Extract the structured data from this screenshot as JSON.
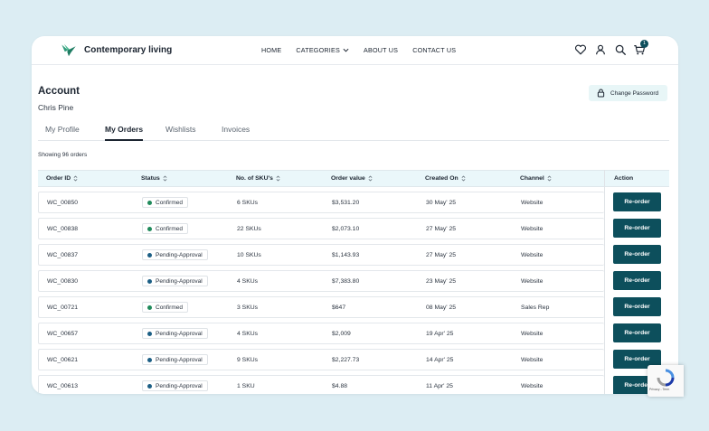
{
  "brand": {
    "name": "Contemporary living",
    "logo_icon": "bird-logo-icon"
  },
  "nav": {
    "items": [
      {
        "label": "HOME"
      },
      {
        "label": "CATEGORIES",
        "has_dropdown": true
      },
      {
        "label": "ABOUT US"
      },
      {
        "label": "CONTACT US"
      }
    ],
    "icons": [
      "heart-icon",
      "user-icon",
      "search-icon",
      "cart-icon"
    ],
    "cart_count": "1"
  },
  "account": {
    "title": "Account",
    "name": "Chris Pine",
    "change_password_label": "Change Password"
  },
  "tabs": [
    {
      "label": "My Profile",
      "active": false
    },
    {
      "label": "My Orders",
      "active": true
    },
    {
      "label": "Wishlists",
      "active": false
    },
    {
      "label": "Invoices",
      "active": false
    }
  ],
  "orders": {
    "showing": "Showing 96 orders",
    "columns": [
      "Order ID",
      "Status",
      "No. of SKU's",
      "Order value",
      "Created On",
      "Channel",
      "Action"
    ],
    "reorder_label": "Re-order",
    "status_colors": {
      "Confirmed": "#1f8a5b",
      "Pending-Approval": "#1c5f85"
    },
    "rows": [
      {
        "id": "WC_00850",
        "status": "Confirmed",
        "skus": "6 SKUs",
        "value": "$3,531.20",
        "created": "30 May' 25",
        "channel": "Website"
      },
      {
        "id": "WC_00838",
        "status": "Confirmed",
        "skus": "22 SKUs",
        "value": "$2,073.10",
        "created": "27 May' 25",
        "channel": "Website"
      },
      {
        "id": "WC_00837",
        "status": "Pending-Approval",
        "skus": "10 SKUs",
        "value": "$1,143.93",
        "created": "27 May' 25",
        "channel": "Website"
      },
      {
        "id": "WC_00830",
        "status": "Pending-Approval",
        "skus": "4 SKUs",
        "value": "$7,383.80",
        "created": "23 May' 25",
        "channel": "Website"
      },
      {
        "id": "WC_00721",
        "status": "Confirmed",
        "skus": "3 SKUs",
        "value": "$647",
        "created": "08 May' 25",
        "channel": "Sales Rep"
      },
      {
        "id": "WC_00657",
        "status": "Pending-Approval",
        "skus": "4 SKUs",
        "value": "$2,009",
        "created": "19 Apr' 25",
        "channel": "Website"
      },
      {
        "id": "WC_00621",
        "status": "Pending-Approval",
        "skus": "9 SKUs",
        "value": "$2,227.73",
        "created": "14 Apr' 25",
        "channel": "Website"
      },
      {
        "id": "WC_00613",
        "status": "Pending-Approval",
        "skus": "1 SKU",
        "value": "$4.88",
        "created": "11 Apr' 25",
        "channel": "Website"
      }
    ]
  },
  "recaptcha": {
    "text": "Privacy - Term"
  }
}
